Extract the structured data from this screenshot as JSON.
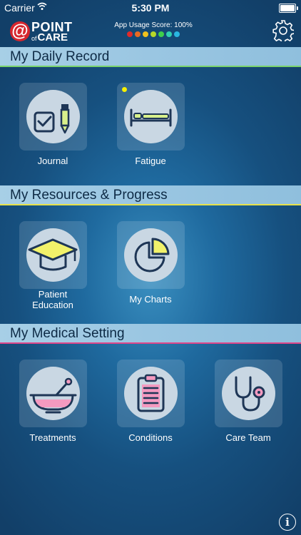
{
  "status_bar": {
    "carrier": "Carrier",
    "time": "5:30 PM",
    "wifi_icon": "wifi-icon",
    "battery_icon": "battery-icon"
  },
  "header": {
    "logo": {
      "symbol": "@",
      "line1": "POINT",
      "of": "of",
      "line2": "CARE",
      "brand_color": "#d6262e"
    },
    "usage_score": {
      "label": "App Usage Score: 100%",
      "value_percent": 100,
      "dot_colors": [
        "#e02a2a",
        "#e86a22",
        "#f0c21d",
        "#b6d829",
        "#3fcf4b",
        "#2fd0b0",
        "#29b7e0"
      ]
    },
    "settings_icon": "gear-icon"
  },
  "sections": [
    {
      "title": "My Daily Record",
      "underline_color": "#79d36b",
      "items": [
        {
          "label": "Journal",
          "icon": "journal-checkbox-pencil-icon"
        },
        {
          "label": "Fatigue",
          "icon": "bed-icon",
          "badge_color": "#f6f000"
        }
      ]
    },
    {
      "title": "My Resources & Progress",
      "underline_color": "#e8e24a",
      "items": [
        {
          "label": "Patient Education",
          "label_line1": "Patient",
          "label_line2": "Education",
          "icon": "graduation-cap-icon"
        },
        {
          "label": "My Charts",
          "icon": "pie-chart-icon"
        }
      ]
    },
    {
      "title": "My Medical Setting",
      "underline_color": "#e0468a",
      "items": [
        {
          "label": "Treatments",
          "icon": "mortar-pestle-icon"
        },
        {
          "label": "Conditions",
          "icon": "clipboard-icon"
        },
        {
          "label": "Care Team",
          "icon": "stethoscope-icon"
        }
      ]
    }
  ],
  "footer": {
    "info_icon": "info-icon",
    "info_symbol": "i"
  }
}
